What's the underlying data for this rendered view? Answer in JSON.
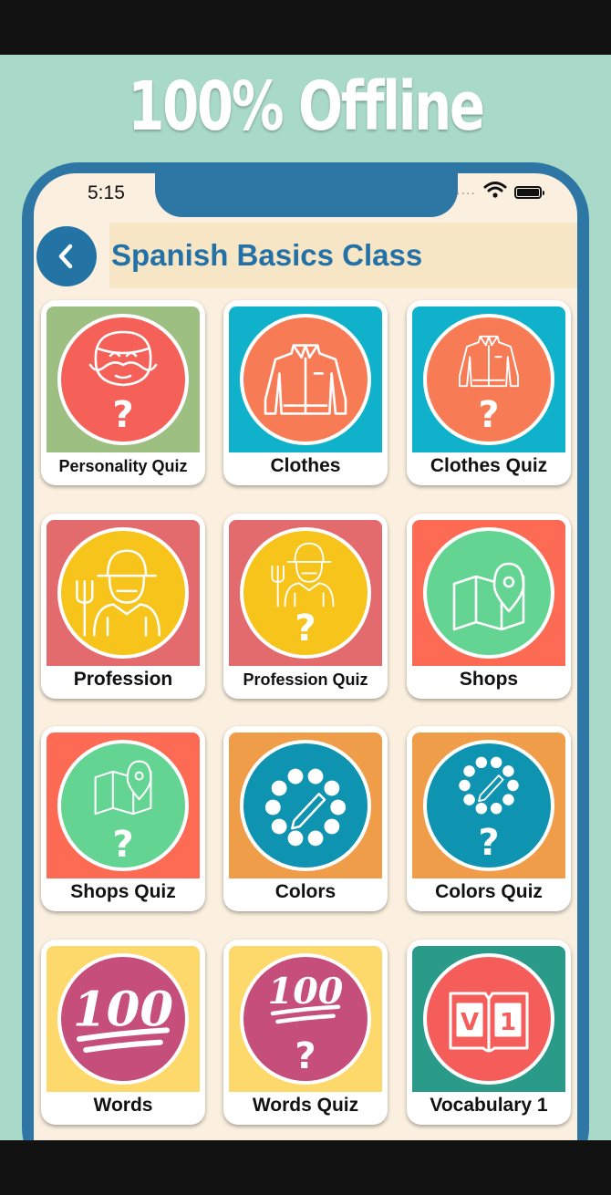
{
  "headline": "100% Offline",
  "status_bar": {
    "time": "5:15",
    "signal_dots": "....",
    "wifi_icon": "wifi-icon",
    "battery_icon": "battery-icon"
  },
  "header": {
    "title": "Spanish Basics Class",
    "back_icon": "chevron-left-icon"
  },
  "tiles": [
    {
      "label": "Personality Quiz",
      "icon": "mustache-face-question-icon",
      "bg": "#9dc082",
      "circle": "#f56058"
    },
    {
      "label": "Clothes",
      "icon": "jacket-icon",
      "bg": "#0fb1cb",
      "circle": "#f77c55"
    },
    {
      "label": "Clothes Quiz",
      "icon": "jacket-question-icon",
      "bg": "#0fb1cb",
      "circle": "#f77c55"
    },
    {
      "label": "Profession",
      "icon": "farmer-icon",
      "bg": "#e36b6e",
      "circle": "#f6c41b"
    },
    {
      "label": "Profession Quiz",
      "icon": "farmer-question-icon",
      "bg": "#e36b6e",
      "circle": "#f6c41b"
    },
    {
      "label": "Shops",
      "icon": "map-pin-icon",
      "bg": "#fd6b55",
      "circle": "#64d493"
    },
    {
      "label": "Shops Quiz",
      "icon": "map-pin-question-icon",
      "bg": "#fd6b55",
      "circle": "#64d493"
    },
    {
      "label": "Colors",
      "icon": "palette-pencil-icon",
      "bg": "#f09d49",
      "circle": "#0e93b0"
    },
    {
      "label": "Colors Quiz",
      "icon": "palette-pencil-question-icon",
      "bg": "#f09d49",
      "circle": "#0e93b0"
    },
    {
      "label": "Words",
      "icon": "hundred-points-icon",
      "bg": "#fdd86b",
      "circle": "#c64e7a"
    },
    {
      "label": "Words Quiz",
      "icon": "hundred-points-question-icon",
      "bg": "#fdd86b",
      "circle": "#c64e7a"
    },
    {
      "label": "Vocabulary 1",
      "icon": "vocabulary-book-icon",
      "bg": "#2a9a89",
      "circle": "#f45d5a"
    }
  ]
}
